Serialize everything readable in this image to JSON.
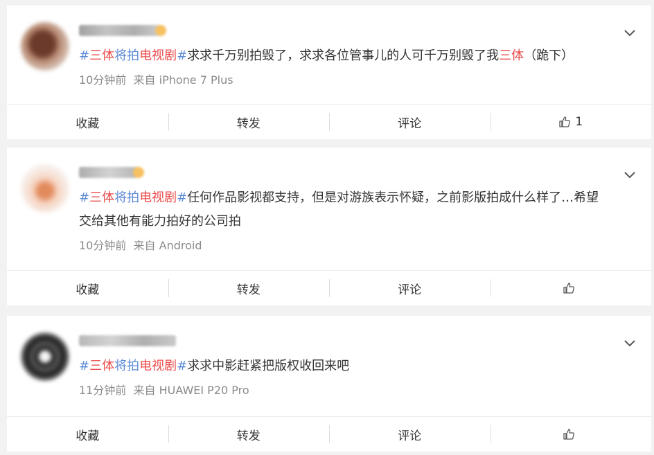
{
  "posts": [
    {
      "hashtag": {
        "hash_open": "#",
        "part1": "三体",
        "part2": "将拍",
        "part3": "电视剧",
        "hash_close": "#"
      },
      "text_a": "求求千万别拍毁了，求求各位管事儿的人可千万别毁了我",
      "keyword": "三体",
      "text_b": "（跪下）",
      "line2": "",
      "time": "10分钟前",
      "source": "来自 iPhone 7 Plus",
      "actions": {
        "favorite": "收藏",
        "repost": "转发",
        "comment": "评论",
        "like_count": "1"
      }
    },
    {
      "hashtag": {
        "hash_open": "#",
        "part1": "三体",
        "part2": "将拍",
        "part3": "电视剧",
        "hash_close": "#"
      },
      "text_a": "任何作品影视都支持，但是对游族表示怀疑，之前影版拍成什么样了…希望",
      "keyword": "",
      "text_b": "",
      "line2": "交给其他有能力拍好的公司拍",
      "time": "10分钟前",
      "source": "来自 Android",
      "actions": {
        "favorite": "收藏",
        "repost": "转发",
        "comment": "评论",
        "like_count": ""
      }
    },
    {
      "hashtag": {
        "hash_open": "#",
        "part1": "三体",
        "part2": "将拍",
        "part3": "电视剧",
        "hash_close": "#"
      },
      "text_a": "求求中影赶紧把版权收回来吧",
      "keyword": "",
      "text_b": "",
      "line2": "",
      "time": "11分钟前",
      "source": "来自 HUAWEI P20 Pro",
      "actions": {
        "favorite": "收藏",
        "repost": "转发",
        "comment": "评论",
        "like_count": ""
      }
    }
  ],
  "colors": {
    "hashtag_blue": "#5c8ad6",
    "hashtag_red": "#eb4c4c",
    "meta_gray": "#8a8a8a",
    "background": "#f2f2f2"
  },
  "icons": {
    "more": "chevron-down-icon",
    "like": "thumbs-up-icon"
  }
}
